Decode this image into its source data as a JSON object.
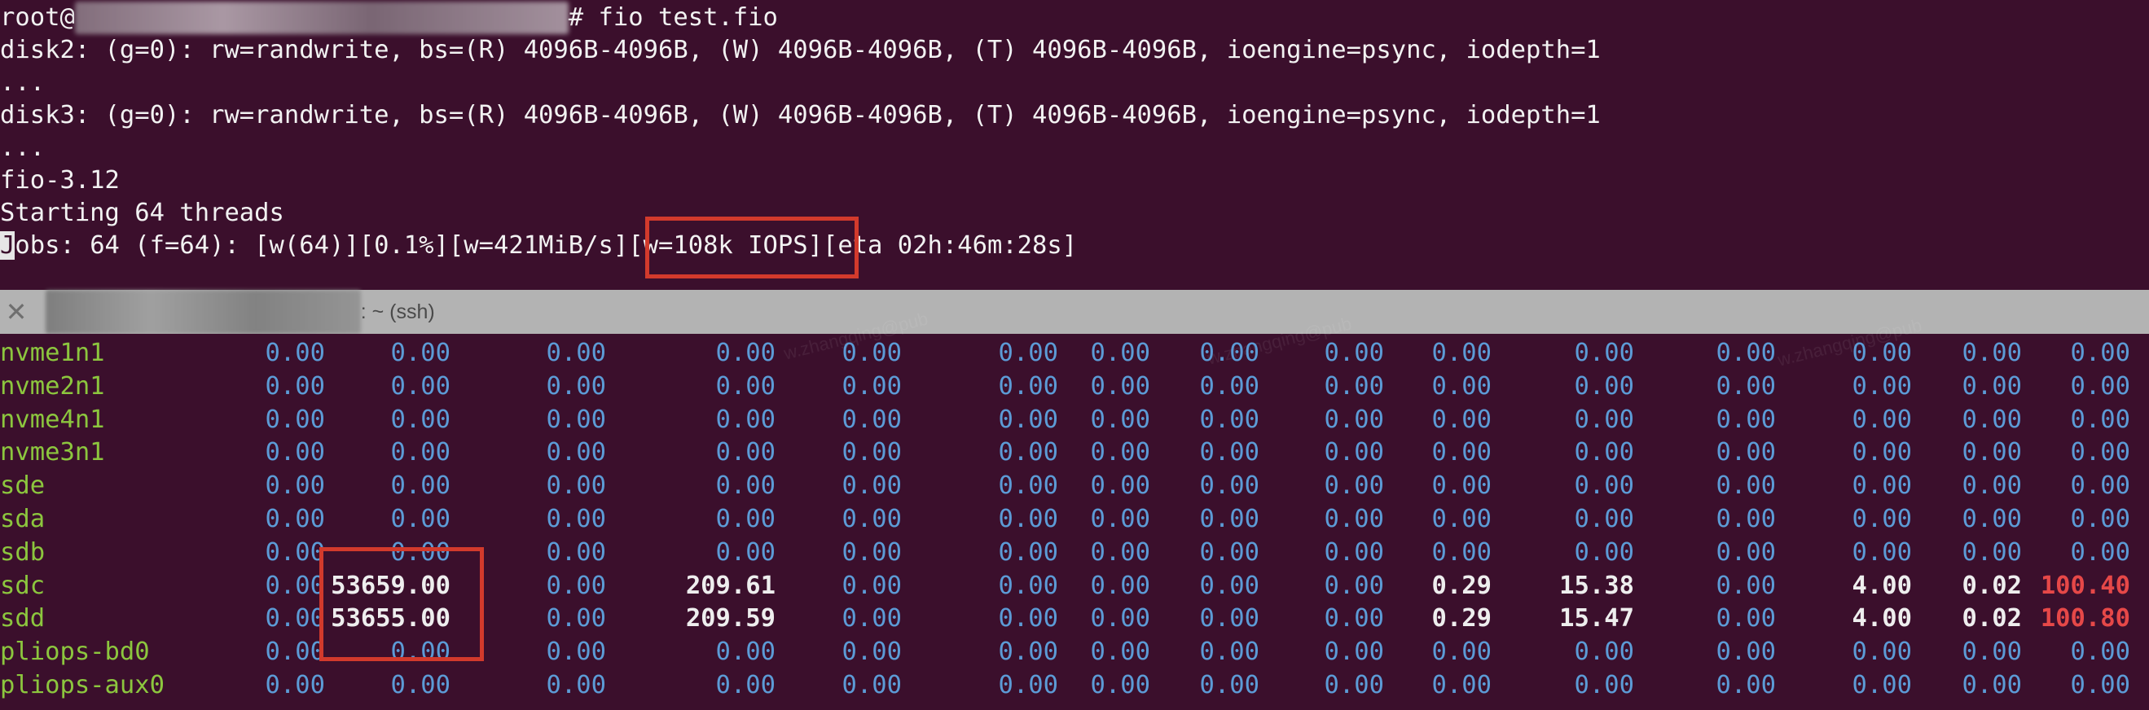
{
  "terminal_top": {
    "prompt_user": "root@",
    "prompt_path_tail": "# ",
    "command": "fio test.fio",
    "lines": [
      "disk2: (g=0): rw=randwrite, bs=(R) 4096B-4096B, (W) 4096B-4096B, (T) 4096B-4096B, ioengine=psync, iodepth=1",
      "...",
      "disk3: (g=0): rw=randwrite, bs=(R) 4096B-4096B, (W) 4096B-4096B, (T) 4096B-4096B, ioengine=psync, iodepth=1",
      "...",
      "fio-3.12",
      "Starting 64 threads"
    ],
    "jobs_cursor_char": "J",
    "jobs_rest": "obs: 64 (f=64): [w(64)][0.1%][w=421MiB/s]",
    "jobs_iops": "[w=108k IOPS]",
    "jobs_eta": "[eta 02h:46m:28s]"
  },
  "pane_header": {
    "close_icon": "close-icon",
    "title_suffix": ": ~ (ssh)"
  },
  "colors": {
    "background": "#3b0f2c",
    "device_name": "#8cc63e",
    "value": "#5c9bd6",
    "value_bold": "#eeeeee",
    "value_alert": "#e64848",
    "highlight_box": "#d23a2c",
    "pane_divider": "#b3b3b3"
  },
  "iostat": {
    "rows": [
      {
        "device": "nvme1n1",
        "values": [
          "0.00",
          "0.00",
          "0.00",
          "0.00",
          "0.00",
          "0.00",
          "0.00",
          "0.00",
          "0.00",
          "0.00",
          "0.00",
          "0.00",
          "0.00",
          "0.00",
          "0.00"
        ]
      },
      {
        "device": "nvme2n1",
        "values": [
          "0.00",
          "0.00",
          "0.00",
          "0.00",
          "0.00",
          "0.00",
          "0.00",
          "0.00",
          "0.00",
          "0.00",
          "0.00",
          "0.00",
          "0.00",
          "0.00",
          "0.00"
        ]
      },
      {
        "device": "nvme4n1",
        "values": [
          "0.00",
          "0.00",
          "0.00",
          "0.00",
          "0.00",
          "0.00",
          "0.00",
          "0.00",
          "0.00",
          "0.00",
          "0.00",
          "0.00",
          "0.00",
          "0.00",
          "0.00"
        ]
      },
      {
        "device": "nvme3n1",
        "values": [
          "0.00",
          "0.00",
          "0.00",
          "0.00",
          "0.00",
          "0.00",
          "0.00",
          "0.00",
          "0.00",
          "0.00",
          "0.00",
          "0.00",
          "0.00",
          "0.00",
          "0.00"
        ]
      },
      {
        "device": "sde",
        "values": [
          "0.00",
          "0.00",
          "0.00",
          "0.00",
          "0.00",
          "0.00",
          "0.00",
          "0.00",
          "0.00",
          "0.00",
          "0.00",
          "0.00",
          "0.00",
          "0.00",
          "0.00"
        ]
      },
      {
        "device": "sda",
        "values": [
          "0.00",
          "0.00",
          "0.00",
          "0.00",
          "0.00",
          "0.00",
          "0.00",
          "0.00",
          "0.00",
          "0.00",
          "0.00",
          "0.00",
          "0.00",
          "0.00",
          "0.00"
        ]
      },
      {
        "device": "sdb",
        "values": [
          "0.00",
          "0.00",
          "0.00",
          "0.00",
          "0.00",
          "0.00",
          "0.00",
          "0.00",
          "0.00",
          "0.00",
          "0.00",
          "0.00",
          "0.00",
          "0.00",
          "0.00"
        ]
      },
      {
        "device": "sdc",
        "values": [
          "0.00",
          "53659.00",
          "0.00",
          "209.61",
          "0.00",
          "0.00",
          "0.00",
          "0.00",
          "0.00",
          "0.29",
          "15.38",
          "0.00",
          "4.00",
          "0.02",
          "100.40"
        ]
      },
      {
        "device": "sdd",
        "values": [
          "0.00",
          "53655.00",
          "0.00",
          "209.59",
          "0.00",
          "0.00",
          "0.00",
          "0.00",
          "0.00",
          "0.29",
          "15.47",
          "0.00",
          "4.00",
          "0.02",
          "100.80"
        ]
      },
      {
        "device": "pliops-bd0",
        "values": [
          "0.00",
          "0.00",
          "0.00",
          "0.00",
          "0.00",
          "0.00",
          "0.00",
          "0.00",
          "0.00",
          "0.00",
          "0.00",
          "0.00",
          "0.00",
          "0.00",
          "0.00"
        ]
      },
      {
        "device": "pliops-aux0",
        "values": [
          "0.00",
          "0.00",
          "0.00",
          "0.00",
          "0.00",
          "0.00",
          "0.00",
          "0.00",
          "0.00",
          "0.00",
          "0.00",
          "0.00",
          "0.00",
          "0.00",
          "0.00"
        ]
      }
    ]
  }
}
